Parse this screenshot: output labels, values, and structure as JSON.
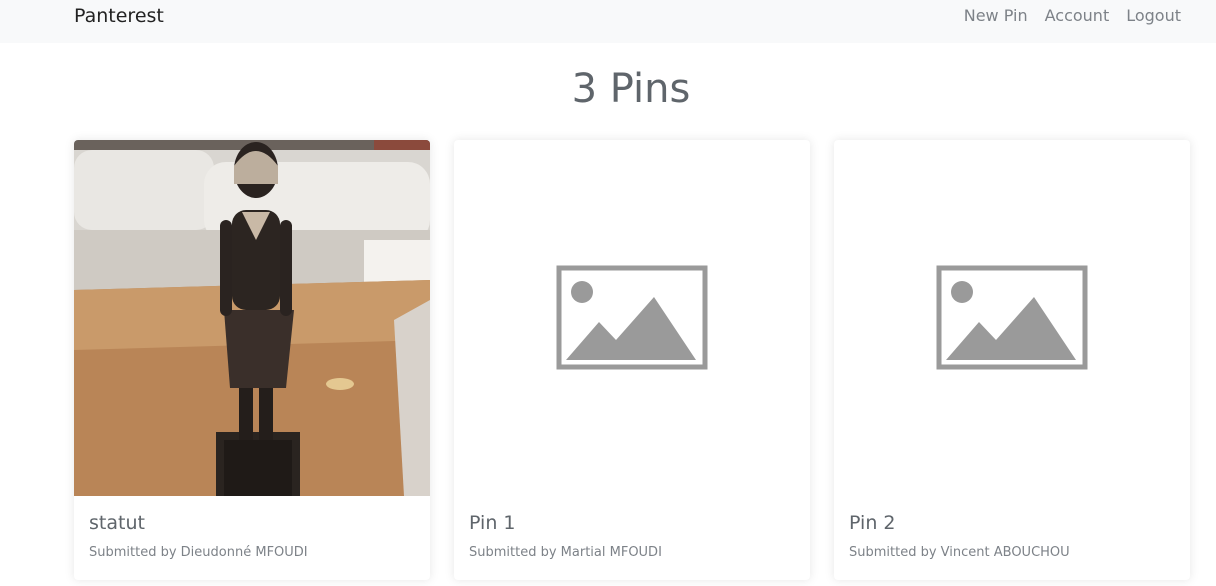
{
  "navbar": {
    "brand": "Panterest",
    "links": [
      {
        "label": "New Pin"
      },
      {
        "label": "Account"
      },
      {
        "label": "Logout"
      }
    ]
  },
  "page": {
    "title": "3 Pins"
  },
  "pins": [
    {
      "title": "statut",
      "submitted": "Submitted by Dieudonné MFOUDI",
      "image": "photo-statue"
    },
    {
      "title": "Pin 1",
      "submitted": "Submitted by Martial MFOUDI",
      "image": "image-placeholder-icon"
    },
    {
      "title": "Pin 2",
      "submitted": "Submitted by Vincent ABOUCHOU",
      "image": "image-placeholder-icon"
    }
  ],
  "colors": {
    "navbar_bg": "#f8f9fa",
    "placeholder_gray": "#9a9a9a"
  }
}
